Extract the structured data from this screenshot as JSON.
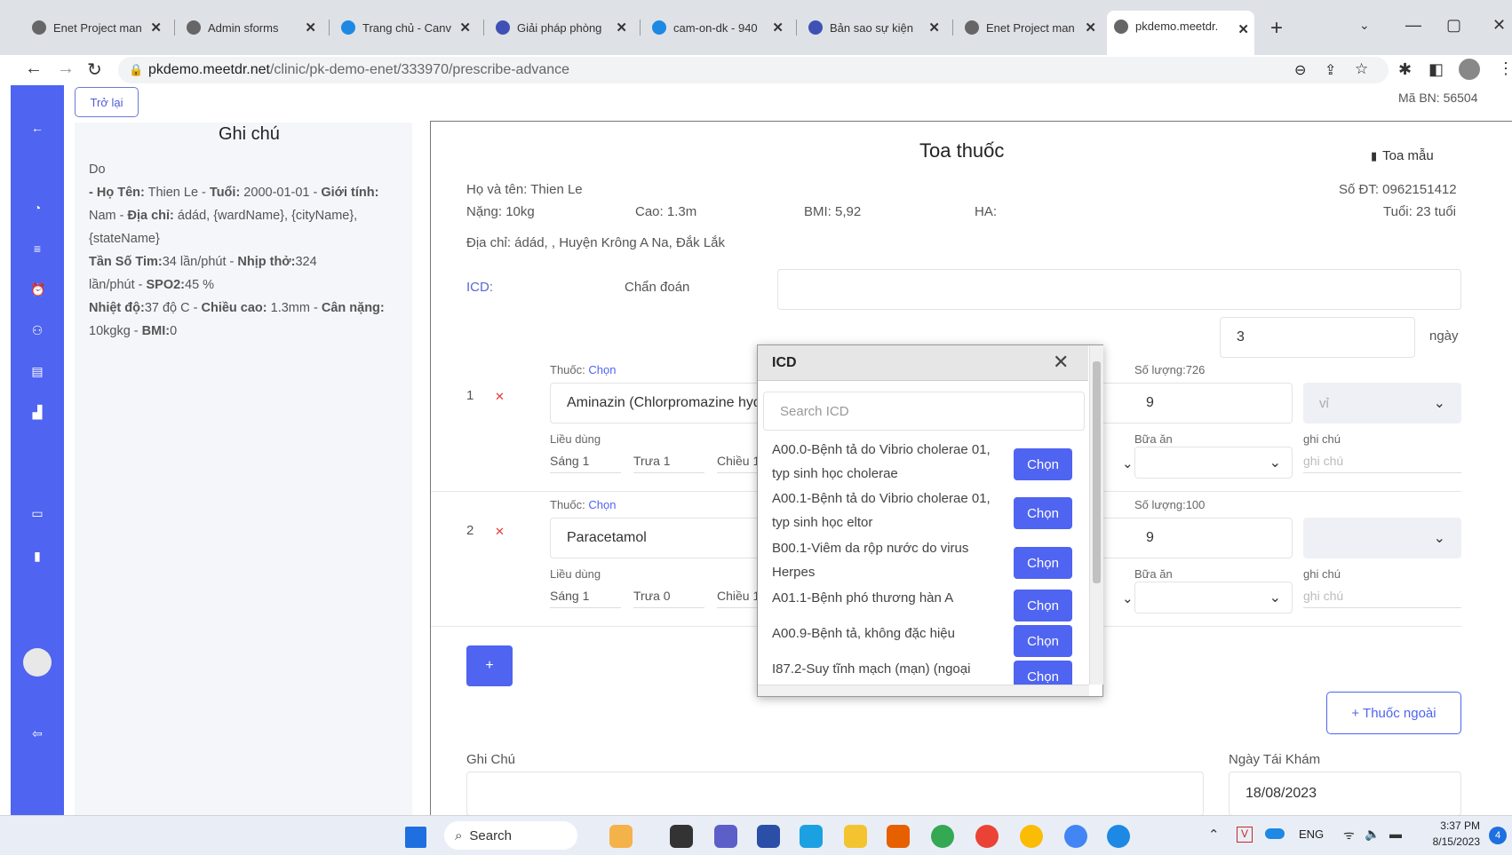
{
  "browser": {
    "tabs": [
      {
        "title": "Enet Project man"
      },
      {
        "title": "Admin sforms"
      },
      {
        "title": "Trang chủ - Canv"
      },
      {
        "title": "Giải pháp phòng"
      },
      {
        "title": "cam-on-dk - 940"
      },
      {
        "title": "Bản sao sự kiện"
      },
      {
        "title": "Enet Project man"
      },
      {
        "title": "pkdemo.meetdr."
      }
    ],
    "url_host": "pkdemo.meetdr.net",
    "url_path": "/clinic/pk-demo-enet/333970/prescribe-advance"
  },
  "page": {
    "back_label": "Trở lại",
    "patient_code": "Mã BN: 56504"
  },
  "notes_panel": {
    "title": "Ghi chú",
    "line0": "Do",
    "l1a": "- Họ Tên:",
    "l1b": " Thien Le - ",
    "l1c": "Tuổi:",
    "l1d": " 2000-01-01 - ",
    "l1e": "Giới tính:",
    "l2a": "Nam - ",
    "l2b": "Địa chỉ:",
    "l2c": " ádád, {wardName}, {cityName},",
    "l3": "{stateName}",
    "l4a": "Tần Số Tim:",
    "l4b": "34 lần/phút - ",
    "l4c": "Nhịp thở:",
    "l4d": "324",
    "l5a": "lần/phút - ",
    "l5b": "SPO2:",
    "l5c": "45 %",
    "l6a": "Nhiệt độ:",
    "l6b": "37 độ C - ",
    "l6c": "Chiều cao:",
    "l6d": " 1.3mm - ",
    "l6e": "Cân nặng:",
    "l7a": "10kgkg - ",
    "l7b": "BMI:",
    "l7c": "0"
  },
  "prescription": {
    "title": "Toa thuốc",
    "template_label": "Toa mẫu",
    "name": "Họ và tên: Thien Le",
    "phone": "Số ĐT: 0962151412",
    "weight": "Nặng: 10kg",
    "height": "Cao: 1.3m",
    "bmi": "BMI: 5,92",
    "ha": "HA:",
    "age": "Tuổi: 23 tuổi",
    "address": "Địa chỉ: ádád, , Huyện Krông A Na, Đắk Lắk",
    "icd_label": "ICD:",
    "diagnosis_label": "Chẩn đoán",
    "days_value": "3",
    "days_unit": "ngày",
    "drugs": [
      {
        "index": "1",
        "drug_label": "Thuốc:",
        "choose": "Chọn",
        "name": "Aminazin (Chlorpromazine hyd",
        "qty_label": "Số lượng:726",
        "qty": "9",
        "unit": "vỉ",
        "dosage_label": "Liều dùng",
        "morning": "Sáng 1",
        "noon": "Trưa 1",
        "afternoon": "Chiều 1",
        "meal_label": "Bữa ăn",
        "note_label": "ghi chú",
        "note_ph": "ghi chú"
      },
      {
        "index": "2",
        "drug_label": "Thuốc:",
        "choose": "Chọn",
        "name": "Paracetamol",
        "qty_label": "Số lượng:100",
        "qty": "9",
        "unit": "",
        "dosage_label": "Liều dùng",
        "morning": "Sáng 1",
        "noon": "Trưa 0",
        "afternoon": "Chiều 1",
        "meal_label": "Bữa ăn",
        "note_label": "ghi chú",
        "note_ph": "ghi chú"
      }
    ],
    "add_label": "+",
    "external_drug_label": "+ Thuốc ngoài",
    "notes_label": "Ghi Chú",
    "revisit_label": "Ngày Tái Khám",
    "revisit_date": "18/08/2023"
  },
  "icd_modal": {
    "title": "ICD",
    "search_placeholder": "Search ICD",
    "items": [
      {
        "text": "A00.0-Bệnh tả do Vibrio cholerae 01, typ sinh học cholerae",
        "button": "Chọn"
      },
      {
        "text": "A00.1-Bệnh tả do Vibrio cholerae 01, typ sinh học eltor",
        "button": "Chọn"
      },
      {
        "text": "B00.1-Viêm da rộp nước do virus Herpes",
        "button": "Chọn"
      },
      {
        "text": "A01.1-Bệnh phó thương hàn A",
        "button": "Chọn"
      },
      {
        "text": "A00.9-Bệnh tả, không đặc hiệu",
        "button": "Chọn"
      },
      {
        "text": "I87.2-Suy tĩnh mạch (mạn) (ngoại",
        "button": "Chọn"
      }
    ]
  },
  "taskbar": {
    "search_label": "Search",
    "lang": "ENG",
    "time": "3:37 PM",
    "date": "8/15/2023",
    "notif_count": "4"
  }
}
